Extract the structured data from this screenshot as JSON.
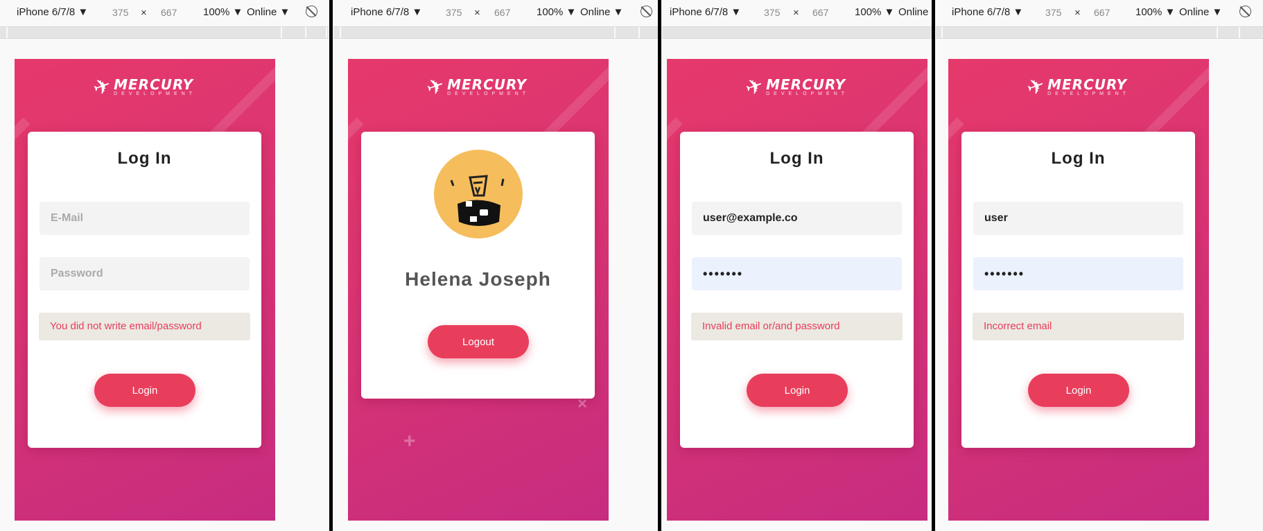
{
  "toolbar": {
    "device": "iPhone 6/7/8 ▼",
    "width": "375",
    "times": "×",
    "height": "667",
    "zoom": "100% ▼",
    "network": "Online ▼",
    "network_partial": "Online"
  },
  "icons": {
    "rotate": "rotate-icon",
    "logo": "mercury-logo-icon",
    "avatar": "monster-avatar-icon",
    "plus": "plus-decoration-icon",
    "cross": "cross-decoration-icon"
  },
  "logo": {
    "main": "MERCURY",
    "sub": "DEVELOPMENT"
  },
  "colors": {
    "brand_gradient_start": "#e6396b",
    "brand_gradient_end": "#c72c80",
    "button": "#e83e5c",
    "error_text": "#e83c5a",
    "error_bg": "#ebe9e2",
    "avatar": "#f5bd5c"
  },
  "screens": [
    {
      "title": "Log In",
      "email_value": "",
      "email_placeholder": "E-Mail",
      "password_value": "",
      "password_placeholder": "Password",
      "error": "You did not write email/password",
      "button": "Login"
    },
    {
      "name": "Helena Joseph",
      "button": "Logout"
    },
    {
      "title": "Log In",
      "email_value": "user@example.co",
      "email_placeholder": "E-Mail",
      "password_value": "•••••••",
      "password_placeholder": "Password",
      "error": "Invalid email or/and password",
      "button": "Login"
    },
    {
      "title": "Log In",
      "email_value": "user",
      "email_placeholder": "E-Mail",
      "password_value": "•••••••",
      "password_placeholder": "Password",
      "error": "Incorrect email",
      "button": "Login"
    }
  ]
}
